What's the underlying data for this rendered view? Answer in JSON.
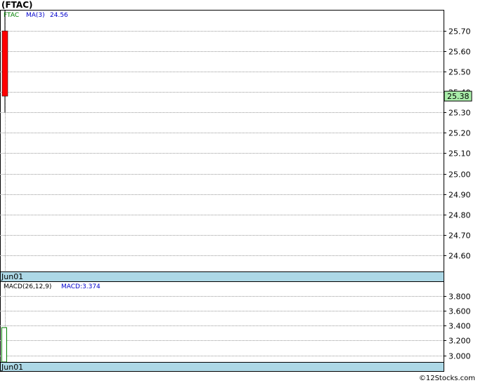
{
  "title": "(FTAC)",
  "credit": "©12Stocks.com",
  "legend_price": {
    "ticker": "FTAC",
    "ma_label": "MA(3)",
    "ma_value": "24.56"
  },
  "legend_macd": {
    "name": "MACD(26,12,9)",
    "value_label": "MACD:3.374"
  },
  "colors": {
    "down_candle": "#ff0000",
    "last_price_bg": "#aaeeaa",
    "date_band": "#add8e6",
    "legend_ticker": "#008000",
    "legend_ma": "#0000cc"
  },
  "chart_data": [
    {
      "type": "candlestick",
      "title": "",
      "x": [
        "Jun01"
      ],
      "candles": [
        {
          "date": "Jun01",
          "open": 25.7,
          "high": 25.8,
          "low": 25.3,
          "close": 25.38
        }
      ],
      "ylim": [
        24.52,
        25.8
      ],
      "yticks": [
        "25.70",
        "25.60",
        "25.50",
        "25.40",
        "25.30",
        "25.20",
        "25.10",
        "25.00",
        "24.90",
        "24.80",
        "24.70",
        "24.60"
      ],
      "last_price": "25.38",
      "xtick_labels": [
        "Jun01"
      ],
      "grid": true
    },
    {
      "type": "bar",
      "title": "",
      "x": [
        "Jun01"
      ],
      "values": [
        3.374
      ],
      "ylim": [
        2.91,
        3.99
      ],
      "yticks": [
        "3.800",
        "3.600",
        "3.400",
        "3.200",
        "3.000"
      ],
      "xtick_labels": [
        "Jun01"
      ],
      "grid": true
    }
  ]
}
